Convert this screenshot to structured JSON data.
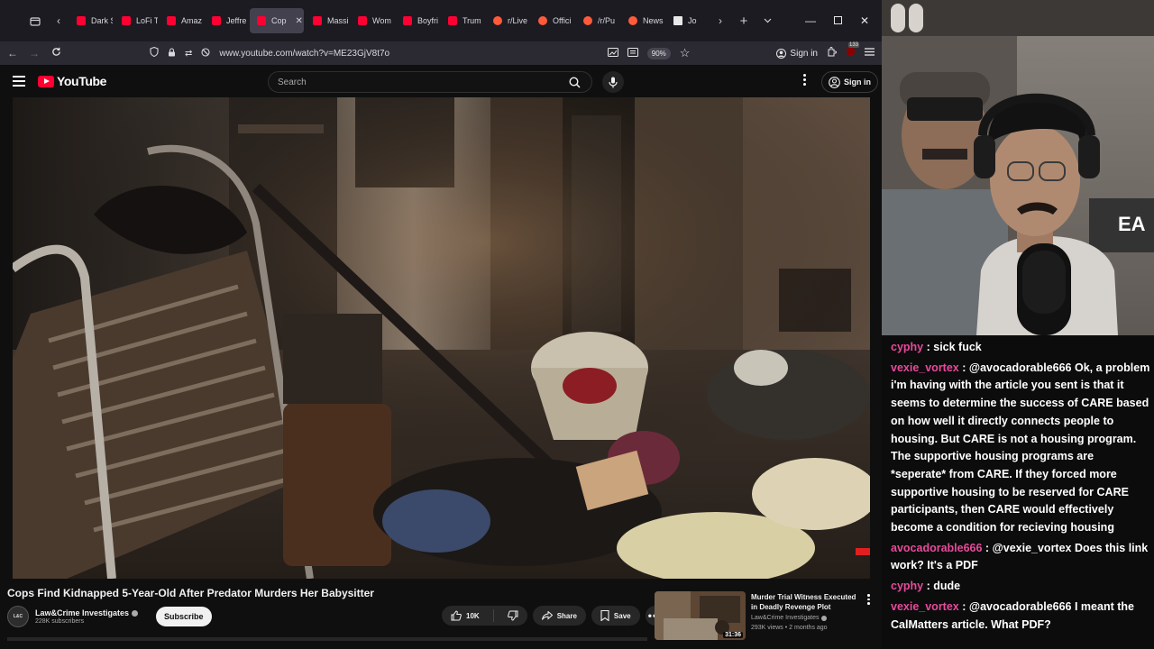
{
  "browser": {
    "tabs": [
      {
        "label": "Dark S",
        "icon": "yt"
      },
      {
        "label": "LoFi T",
        "icon": "yt"
      },
      {
        "label": "Amaz",
        "icon": "yt"
      },
      {
        "label": "Jeffre",
        "icon": "yt"
      },
      {
        "label": "Cop",
        "icon": "yt",
        "active": true
      },
      {
        "label": "Massi",
        "icon": "yt"
      },
      {
        "label": "Wom",
        "icon": "yt"
      },
      {
        "label": "Boyfri",
        "icon": "yt"
      },
      {
        "label": "Trum",
        "icon": "yt"
      },
      {
        "label": "r/Live",
        "icon": "rd"
      },
      {
        "label": "Offici",
        "icon": "rd"
      },
      {
        "label": "/r/Pu",
        "icon": "rd"
      },
      {
        "label": "News",
        "icon": "rd"
      },
      {
        "label": "Jo",
        "icon": "jo"
      }
    ],
    "url": "www.youtube.com/watch?v=ME23GjV8t7o",
    "zoom": "90%",
    "signin_label": "Sign in",
    "badge_count": "133"
  },
  "youtube": {
    "logo_text": "YouTube",
    "search_placeholder": "Search",
    "signin_label": "Sign in"
  },
  "video": {
    "title": "Cops Find Kidnapped 5-Year-Old After Predator Murders Her Babysitter",
    "channel": "Law&Crime Investigates",
    "subscribers": "228K subscribers",
    "subscribe_label": "Subscribe",
    "likes": "10K",
    "share_label": "Share",
    "save_label": "Save"
  },
  "recommended": [
    {
      "title": "Murder Trial Witness Executed in Deadly Revenge Plot",
      "channel": "Law&Crime Investigates",
      "views": "293K views",
      "age": "2 months ago",
      "duration": "31:36"
    }
  ],
  "chat": [
    {
      "user": "cyphy",
      "text": "sick fuck"
    },
    {
      "user": "vexie_vortex",
      "text": "@avocadorable666 Ok, a problem i'm having with the article you sent is that it seems to determine the success of CARE based on how well it directly connects people to housing. But CARE is not a housing program. The supportive housing programs are *seperate* from CARE. If they forced more supportive housing to be reserved for CARE participants, then CARE would effectively become a condition for recieving housing"
    },
    {
      "user": "avocadorable666",
      "text": "@vexie_vortex Does this link work? It's a PDF"
    },
    {
      "user": "cyphy",
      "text": "dude"
    },
    {
      "user": "vexie_vortex",
      "text": "@avocadorable666 I meant the CalMatters article. What PDF?"
    }
  ],
  "colors": {
    "chat_username": "#e84a9a",
    "yt_red": "#ff0033",
    "tab_active": "#42414d"
  }
}
